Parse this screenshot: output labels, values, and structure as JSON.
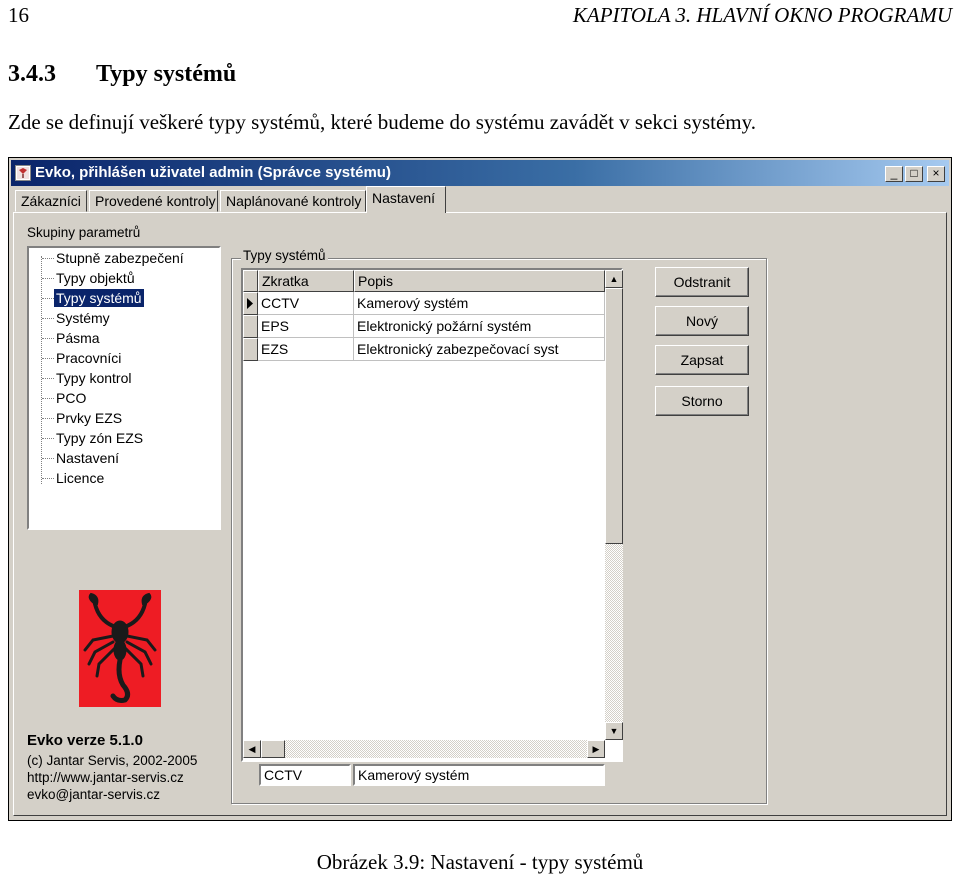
{
  "page": {
    "page_number": "16",
    "chapter_header": "KAPITOLA 3.  HLAVNÍ OKNO PROGRAMU",
    "section_number": "3.4.3",
    "section_title": "Typy systémů",
    "intro": "Zde se definují veškeré typy systémů, které budeme do systému zavádět v sekci systémy.",
    "caption": "Obrázek 3.9: Nastavení - typy systémů"
  },
  "window": {
    "title": "Evko, přihlášen uživatel admin (Správce systému)",
    "controls": [
      "_",
      "□",
      "×"
    ]
  },
  "tabs": [
    "Zákazníci",
    "Provedené kontroly",
    "Naplánované kontroly",
    "Nastavení"
  ],
  "active_tab": "Nastavení",
  "parameter_groups": {
    "label": "Skupiny parametrů",
    "items": [
      "Stupně zabezpečení",
      "Typy objektů",
      "Typy systémů",
      "Systémy",
      "Pásma",
      "Pracovníci",
      "Typy kontrol",
      "PCO",
      "Prvky EZS",
      "Typy zón EZS",
      "Nastavení",
      "Licence"
    ],
    "selected": "Typy systémů"
  },
  "systems_panel": {
    "label": "Typy systémů",
    "columns": [
      "Zkratka",
      "Popis"
    ],
    "rows": [
      {
        "code": "CCTV",
        "desc": "Kamerový systém"
      },
      {
        "code": "EPS",
        "desc": "Elektronický  požární systém"
      },
      {
        "code": "EZS",
        "desc": "Elektronický zabezpečovací syst"
      }
    ],
    "edit_code": "CCTV",
    "edit_desc": "Kamerový systém"
  },
  "buttons": {
    "remove": "Odstranit",
    "new": "Nový",
    "save": "Zapsat",
    "cancel": "Storno"
  },
  "about": {
    "version": "Evko verze 5.1.0",
    "copyright": "(c) Jantar Servis, 2002-2005",
    "web": "http://www.jantar-servis.cz",
    "email": "evko@jantar-servis.cz"
  },
  "colors": {
    "title_bar": "#0a246a",
    "window_face": "#d4d0c8",
    "selection": "#0a246a",
    "logo_red": "#ee1c24"
  }
}
